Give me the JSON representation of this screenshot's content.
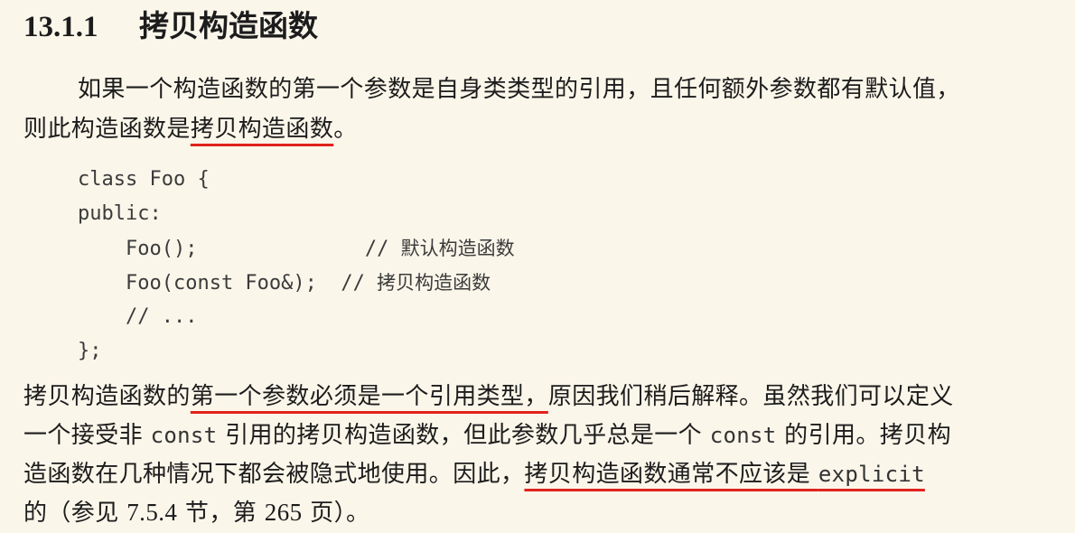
{
  "section": {
    "number": "13.1.1",
    "title": "拷贝构造函数"
  },
  "para1": {
    "line1": "如果一个构造函数的第一个参数是自身类类型的引用，且任何额外参数都有默认值，",
    "line2_a": "则此构造函数是",
    "line2_term": "拷贝构造函数",
    "line2_b": "。"
  },
  "code": {
    "l1": "class Foo {",
    "l2": "public:",
    "l3_code": "    Foo();              // ",
    "l3_comment": "默认构造函数",
    "l4_code": "    Foo(const Foo&);  // ",
    "l4_comment": "拷贝构造函数",
    "l5": "    // ...",
    "l6": "};"
  },
  "para2": {
    "l1_a": "拷贝构造函数的",
    "l1_u": "第一个参数必须是一个引用类型，",
    "l1_b": "原因我们稍后解释。虽然我们可以定义",
    "l2_a": "一个接受非 ",
    "l2_kw1": "const",
    "l2_b": " 引用的拷贝构造函数，但此参数几乎总是一个 ",
    "l2_kw2": "const",
    "l2_c": " 的引用。拷贝构",
    "l3_a": "造函数在几种情况下都会被隐式地使用。因此，",
    "l3_u": "拷贝构造函数通常不应该是 ",
    "l3_kw": "explicit",
    "l4_a": "的（参见 ",
    "l4_sec": "7.5.4",
    "l4_b": " 节，第 ",
    "l4_page": "265",
    "l4_c": " 页）。"
  },
  "colors": {
    "background": "#fbf6ea",
    "underline": "#e0231d",
    "text": "#1c1c1c"
  }
}
